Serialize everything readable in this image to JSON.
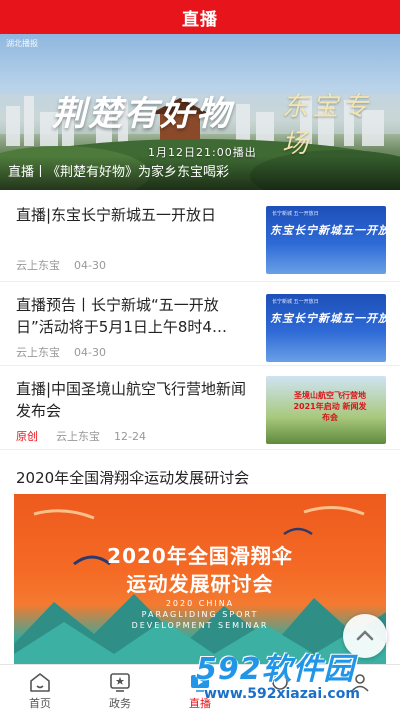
{
  "header": {
    "title": "直播"
  },
  "banner": {
    "corner_logo": "湖北播报",
    "calligraphy": "荆楚有好物",
    "calligraphy_side": "东宝专场",
    "date": "1月12日21:00播出",
    "caption": "直播丨《荆楚有好物》为家乡东宝喝彩"
  },
  "news": [
    {
      "title": "直播|东宝长宁新城五一开放日",
      "original": "",
      "source": "云上东宝",
      "date": "04-30",
      "thumb": {
        "style": "blue",
        "line1": "长宁新城 五一开放日",
        "big": "东宝长宁新城五一开放日"
      }
    },
    {
      "title": "直播预告丨长宁新城“五一开放日”活动将于5月1日上午8时4…",
      "original": "",
      "source": "云上东宝",
      "date": "04-30",
      "thumb": {
        "style": "blue",
        "line1": "长宁新城 五一开放日",
        "big": "东宝长宁新城五一开放日"
      }
    },
    {
      "title": "直播|中国圣境山航空飞行营地新闻发布会",
      "original": "原创",
      "source": "云上东宝",
      "date": "12-24",
      "thumb": {
        "style": "sky",
        "line1": "",
        "big": "圣境山航空飞行营地 2021年启动 新闻发布会"
      }
    }
  ],
  "feature": {
    "title": "2020年全国滑翔伞运动发展研讨会",
    "image_title_1": "2020年全国滑翔伞",
    "image_title_2": "运动发展研讨会",
    "image_en_1": "2020 CHINA",
    "image_en_2": "PARAGLIDING SPORT",
    "image_en_3": "DEVELOPMENT SEMINAR"
  },
  "tabbar": {
    "items": [
      {
        "label": "首页",
        "icon": "home-icon"
      },
      {
        "label": "政务",
        "icon": "government-icon"
      },
      {
        "label": "直播",
        "icon": "live-tv-icon"
      },
      {
        "label": "",
        "icon": "tab-icon"
      },
      {
        "label": "",
        "icon": "tab-icon"
      }
    ],
    "active_index": 2
  },
  "watermark": {
    "brand": "592软件园",
    "url": "www.592xiazai.com"
  },
  "colors": {
    "brand_red": "#e8141b",
    "text": "#222222",
    "meta": "#999999"
  }
}
